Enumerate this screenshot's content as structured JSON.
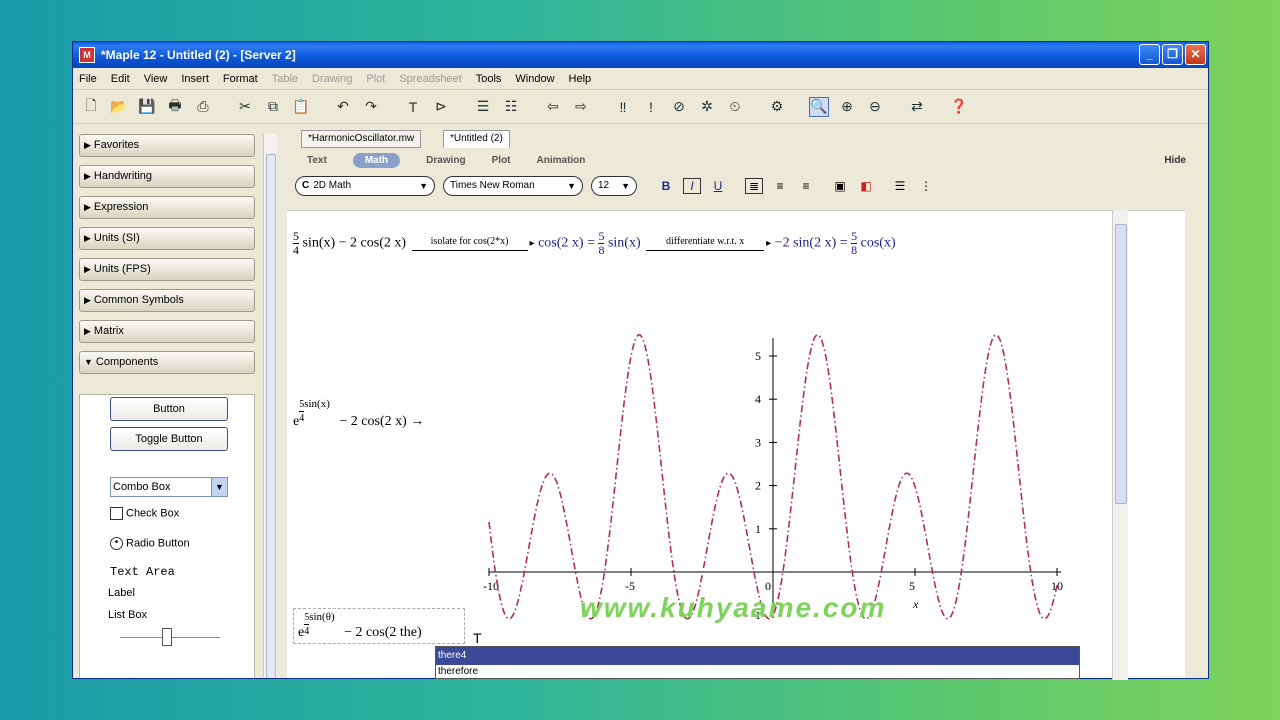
{
  "window": {
    "title": "*Maple 12 - Untitled (2) - [Server 2]"
  },
  "menu": [
    "File",
    "Edit",
    "View",
    "Insert",
    "Format",
    "Table",
    "Drawing",
    "Plot",
    "Spreadsheet",
    "Tools",
    "Window",
    "Help"
  ],
  "palettes": [
    "Favorites",
    "Handwriting",
    "Expression",
    "Units (SI)",
    "Units (FPS)",
    "Common Symbols",
    "Matrix",
    "Components"
  ],
  "components": {
    "button": "Button",
    "toggle": "Toggle Button",
    "combo": "Combo Box",
    "check": "Check Box",
    "radio": "Radio Button",
    "textarea": "Text Area",
    "label": "Label",
    "listbox": "List Box"
  },
  "tabs": [
    "*HarmonicOscillator.mw",
    "*Untitled (2)"
  ],
  "context": {
    "items": [
      "Text",
      "Math",
      "Drawing",
      "Plot",
      "Animation"
    ],
    "active": "Math",
    "hide": "Hide"
  },
  "format": {
    "mode": "2D Math",
    "font": "Times New Roman",
    "size": "12"
  },
  "equation": {
    "f1_num": "5",
    "f1_den": "4",
    "p1": "sin(x) − 2 cos(2 x)",
    "arrow1": "isolate for cos(2*x)",
    "p2": "cos(2 x) =",
    "f2_num": "5",
    "f2_den": "8",
    "p3": "sin(x)",
    "arrow2": "differentiate w.r.t. x",
    "p4": "−2 sin(2 x) =",
    "f3_num": "5",
    "f3_den": "8",
    "p5": "cos(x)"
  },
  "expr2": {
    "base": "e",
    "exp_num": "5",
    "exp_den": "4",
    "exp_fn": "sin(x)",
    "rest": "− 2 cos(2 x) →"
  },
  "expr3": {
    "base": "e",
    "exp_num": "5",
    "exp_den": "4",
    "exp_fn": "sin(θ)",
    "rest": "− 2 cos(2 the)"
  },
  "autocomplete": [
    "there4",
    "therefore"
  ],
  "watermark": "www.kuhyaame.com",
  "chart_data": {
    "type": "line",
    "function": "exp((5/4)*sin(x)) - 2*cos(2*x)",
    "xlim": [
      -10,
      10
    ],
    "ylim": [
      -1,
      5.5
    ],
    "xticks": [
      -10,
      -5,
      0,
      5,
      10
    ],
    "yticks": [
      1,
      2,
      3,
      4,
      5
    ],
    "xlabel": "x",
    "ylabel": "",
    "color": "#b03050",
    "style": "dash-dot"
  }
}
